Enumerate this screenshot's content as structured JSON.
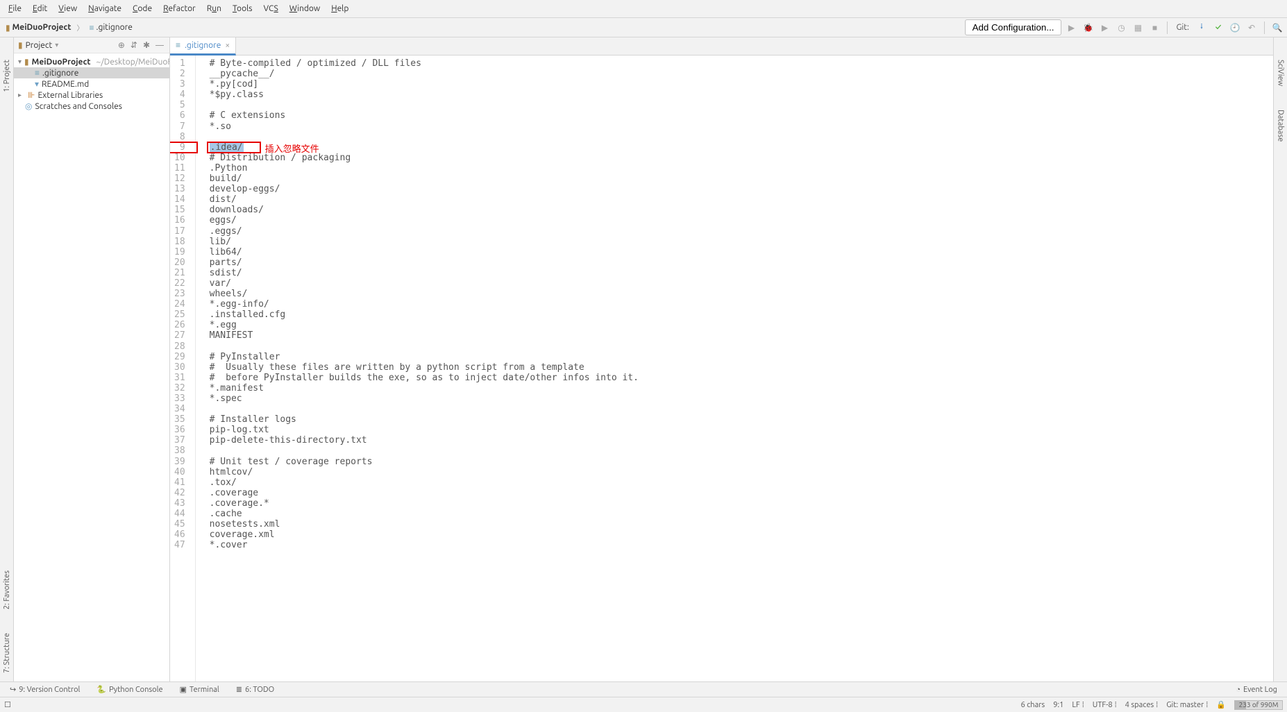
{
  "menubar": [
    "File",
    "Edit",
    "View",
    "Navigate",
    "Code",
    "Refactor",
    "Run",
    "Tools",
    "VCS",
    "Window",
    "Help"
  ],
  "breadcrumb": {
    "root_icon": "folder-icon",
    "root": "MeiDuoProject",
    "file_icon": "file-icon",
    "file": ".gitignore"
  },
  "navbar_right": {
    "add_config": "Add Configuration...",
    "git_label": "Git:"
  },
  "project_panel": {
    "title": "Project",
    "tree": {
      "root_label": "MeiDuoProject",
      "root_path": "~/Desktop/MeiDuoF",
      "children": [
        {
          "label": ".gitignore",
          "selected": true
        },
        {
          "label": "README.md",
          "selected": false
        }
      ],
      "external_libs": "External Libraries",
      "scratches": "Scratches and Consoles"
    }
  },
  "editor_tab": {
    "filename": ".gitignore"
  },
  "code_lines": [
    "# Byte-compiled / optimized / DLL files",
    "__pycache__/",
    "*.py[cod]",
    "*$py.class",
    "",
    "# C extensions",
    "*.so",
    "",
    ".idea/",
    "# Distribution / packaging",
    ".Python",
    "build/",
    "develop-eggs/",
    "dist/",
    "downloads/",
    "eggs/",
    ".eggs/",
    "lib/",
    "lib64/",
    "parts/",
    "sdist/",
    "var/",
    "wheels/",
    "*.egg-info/",
    ".installed.cfg",
    "*.egg",
    "MANIFEST",
    "",
    "# PyInstaller",
    "#  Usually these files are written by a python script from a template",
    "#  before PyInstaller builds the exe, so as to inject date/other infos into it.",
    "*.manifest",
    "*.spec",
    "",
    "# Installer logs",
    "pip-log.txt",
    "pip-delete-this-directory.txt",
    "",
    "# Unit test / coverage reports",
    "htmlcov/",
    ".tox/",
    ".coverage",
    ".coverage.*",
    ".cache",
    "nosetests.xml",
    "coverage.xml",
    "*.cover"
  ],
  "highlighted_line": 9,
  "annotation_text": "插入忽略文件",
  "bottom_tabs": {
    "version_control": "9: Version Control",
    "python_console": "Python Console",
    "terminal": "Terminal",
    "todo": "6: TODO",
    "event_log": "Event Log"
  },
  "status_bar": {
    "chars": "6 chars",
    "position": "9:1",
    "lf": "LF",
    "encoding": "UTF-8",
    "indent": "4 spaces",
    "branch": "Git: master",
    "memory": "233 of 990M"
  },
  "left_toolwin": {
    "project": "1: Project",
    "favorites": "2: Favorites",
    "structure": "7: Structure"
  },
  "right_toolwin": {
    "sciview": "SciView",
    "database": "Database"
  }
}
